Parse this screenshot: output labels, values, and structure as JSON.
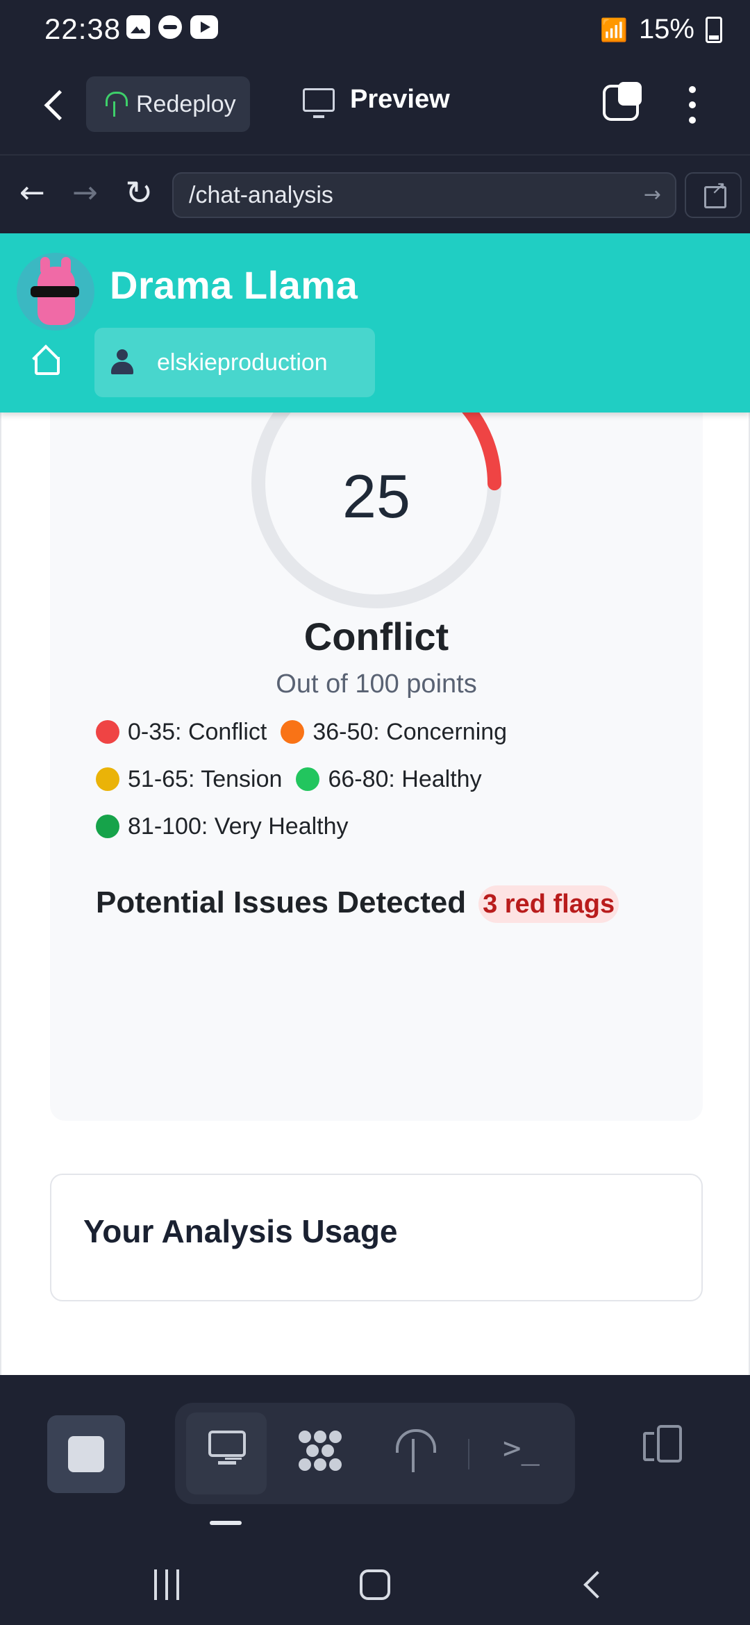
{
  "status_bar": {
    "time": "22:38",
    "battery": "15%"
  },
  "app_bar": {
    "redeploy_label": "Redeploy",
    "preview_label": "Preview"
  },
  "url_bar": {
    "url": "/chat-analysis"
  },
  "site": {
    "brand": "Drama Llama",
    "username": "elskieproduction"
  },
  "score": {
    "value": "25",
    "gauge_fraction": 0.25,
    "gauge_color": "#ef4444",
    "track_color": "#e5e7eb",
    "status": "Conflict",
    "subtitle": "Out of 100 points"
  },
  "legend": [
    {
      "label": "0-35: Conflict",
      "color": "#ef4444"
    },
    {
      "label": "36-50: Concerning",
      "color": "#f97316"
    },
    {
      "label": "51-65: Tension",
      "color": "#eab308"
    },
    {
      "label": "66-80: Healthy",
      "color": "#22c55e"
    },
    {
      "label": "81-100: Very Healthy",
      "color": "#16a34a"
    }
  ],
  "issues": {
    "heading": "Potential Issues Detected",
    "badge": "3 red flags"
  },
  "usage": {
    "title": "Your Analysis Usage"
  },
  "icons": {
    "back": "back-arrow-icon",
    "redeploy": "deploy-icon",
    "preview": "monitor-icon",
    "tabs": "tabs-icon",
    "more": "more-vertical-icon",
    "home": "home-icon",
    "user": "user-icon"
  }
}
